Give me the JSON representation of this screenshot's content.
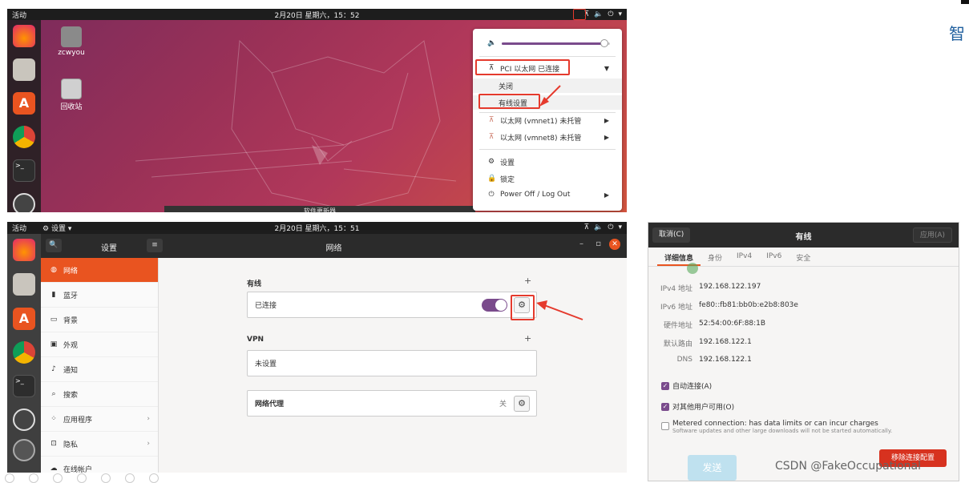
{
  "desktop": {
    "activities": "活动",
    "clock": "2月20日 星期六，15：52",
    "desktop_icons": [
      {
        "label": "zcwyou",
        "icon": "home-folder-icon"
      },
      {
        "label": "回收站",
        "icon": "trash-icon"
      }
    ],
    "bottom_text": "软件更新器",
    "system_menu": {
      "pci_item": "PCI 以太网 已连接",
      "close_item": "关闭",
      "wired_settings_item": "有线设置",
      "vmnet1_item": "以太网 (vmnet1) 未托管",
      "vmnet8_item": "以太网 (vmnet8) 未托管",
      "settings_item": "设置",
      "lock_item": "锁定",
      "power_item": "Power Off / Log Out",
      "volume_level": 0.95
    }
  },
  "settings": {
    "activities": "活动",
    "app_menu": "设置",
    "clock": "2月20日 星期六，15：51",
    "sidebar_title": "设置",
    "page_title": "网络",
    "sidebar_items": [
      {
        "label": "网络",
        "icon": "network-icon"
      },
      {
        "label": "蓝牙",
        "icon": "bluetooth-icon"
      },
      {
        "label": "背景",
        "icon": "background-icon"
      },
      {
        "label": "外观",
        "icon": "appearance-icon"
      },
      {
        "label": "通知",
        "icon": "bell-icon"
      },
      {
        "label": "搜索",
        "icon": "search-icon"
      },
      {
        "label": "应用程序",
        "icon": "apps-icon"
      },
      {
        "label": "隐私",
        "icon": "lock-icon"
      },
      {
        "label": "在线帐户",
        "icon": "cloud-icon"
      }
    ],
    "wired_section": "有线",
    "wired_status": "已连接",
    "vpn_section": "VPN",
    "vpn_status": "未设置",
    "proxy_label": "网络代理",
    "proxy_status": "关"
  },
  "dialog": {
    "cancel": "取消(C)",
    "title": "有线",
    "apply": "应用(A)",
    "tabs": [
      "详细信息",
      "身份",
      "IPv4",
      "IPv6",
      "安全"
    ],
    "details": [
      {
        "key": "IPv4 地址",
        "value": "192.168.122.197"
      },
      {
        "key": "IPv6 地址",
        "value": "fe80::fb81:bb0b:e2b8:803e"
      },
      {
        "key": "硬件地址",
        "value": "52:54:00:6F:88:1B"
      },
      {
        "key": "默认路由",
        "value": "192.168.122.1"
      },
      {
        "key": "DNS",
        "value": "192.168.122.1"
      }
    ],
    "auto_connect": "自动连接(A)",
    "all_users": "对其他用户可用(O)",
    "metered": "Metered connection: has data limits or can incur charges",
    "metered_sub": "Software updates and other large downloads will not be started automatically.",
    "remove": "移除连接配置"
  },
  "page": {
    "side_char": "智",
    "send_button": "发送",
    "watermark": "CSDN @FakeOccupational"
  },
  "colors": {
    "accent": "#e95420",
    "annotation": "#e53a2d",
    "toggle": "#7a4b8c"
  }
}
